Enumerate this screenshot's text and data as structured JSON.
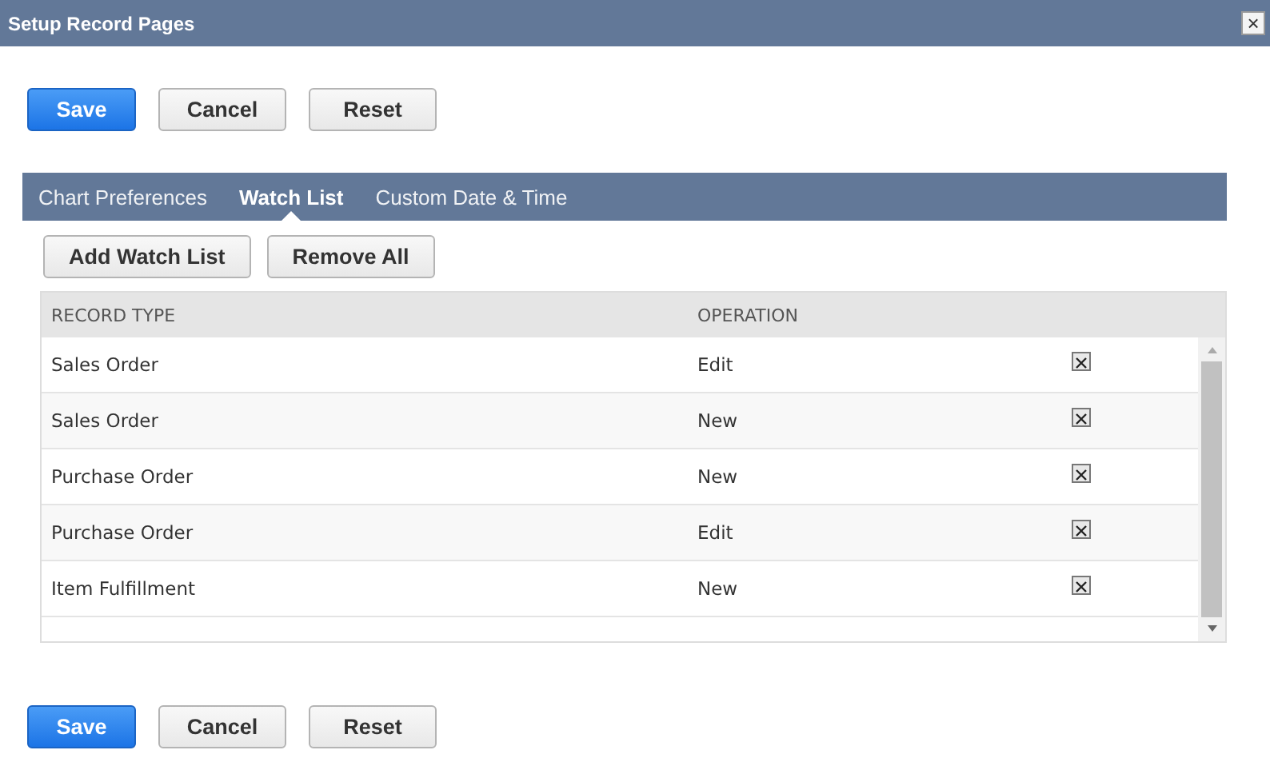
{
  "window": {
    "title": "Setup Record Pages",
    "close": "×"
  },
  "top_buttons": [
    {
      "label": "Save",
      "kind": "primary"
    },
    {
      "label": "Cancel",
      "kind": "secondary"
    },
    {
      "label": "Reset",
      "kind": "secondary"
    }
  ],
  "tabs": [
    {
      "label": "Chart Preferences",
      "selected": false
    },
    {
      "label": "Watch List",
      "selected": true
    },
    {
      "label": "Custom Date & Time",
      "selected": false
    }
  ],
  "list_buttons": [
    "Add Watch List",
    "Remove All"
  ],
  "table": {
    "columns": [
      "RECORD TYPE",
      "OPERATION"
    ],
    "rows": [
      {
        "record_type": "Sales Order",
        "operation": "Edit"
      },
      {
        "record_type": "Sales Order",
        "operation": "New"
      },
      {
        "record_type": "Purchase Order",
        "operation": "New"
      },
      {
        "record_type": "Purchase Order",
        "operation": "Edit"
      },
      {
        "record_type": "Item Fulfillment",
        "operation": "New"
      }
    ]
  },
  "bottom_buttons": [
    {
      "label": "Save",
      "kind": "primary"
    },
    {
      "label": "Cancel",
      "kind": "secondary"
    },
    {
      "label": "Reset",
      "kind": "secondary"
    }
  ]
}
